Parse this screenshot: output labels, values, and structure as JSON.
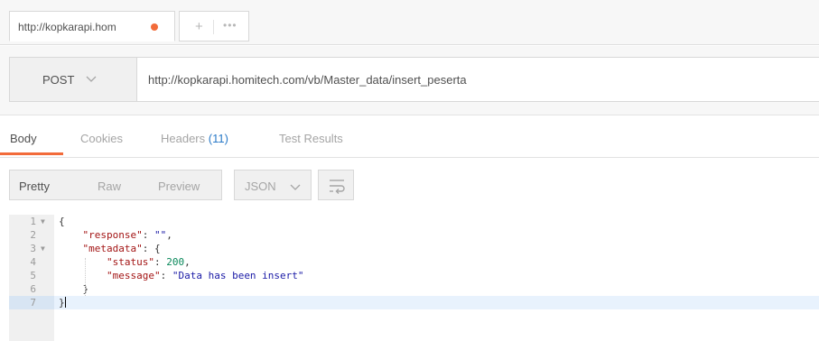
{
  "tabs": {
    "request_tab_label": "http://kopkarapi.hom",
    "add_tab_symbol": "+",
    "more_symbol": "•••",
    "unsaved_color": "#f26b3a"
  },
  "request": {
    "method": "POST",
    "url": "http://kopkarapi.homitech.com/vb/Master_data/insert_peserta"
  },
  "response_tabs": {
    "body": "Body",
    "cookies": "Cookies",
    "headers": "Headers",
    "headers_count": "(11)",
    "test_results": "Test Results"
  },
  "toolbar": {
    "pretty": "Pretty",
    "raw": "Raw",
    "preview": "Preview",
    "format": "JSON"
  },
  "editor": {
    "line_numbers": [
      "1",
      "2",
      "3",
      "4",
      "5",
      "6",
      "7"
    ],
    "open_brace": "{",
    "key_response": "\"response\"",
    "val_response": "\"\"",
    "key_metadata": "\"metadata\"",
    "key_status": "\"status\"",
    "val_status": "200",
    "key_message": "\"message\"",
    "val_message": "\"Data has been insert\"",
    "close_inner": "}",
    "close_outer": "}"
  },
  "colors": {
    "accent": "#f26b3a",
    "headers_count": "#2a7ac8",
    "json_key": "#a31515",
    "json_string": "#1a1aa6",
    "json_number": "#09885a"
  }
}
